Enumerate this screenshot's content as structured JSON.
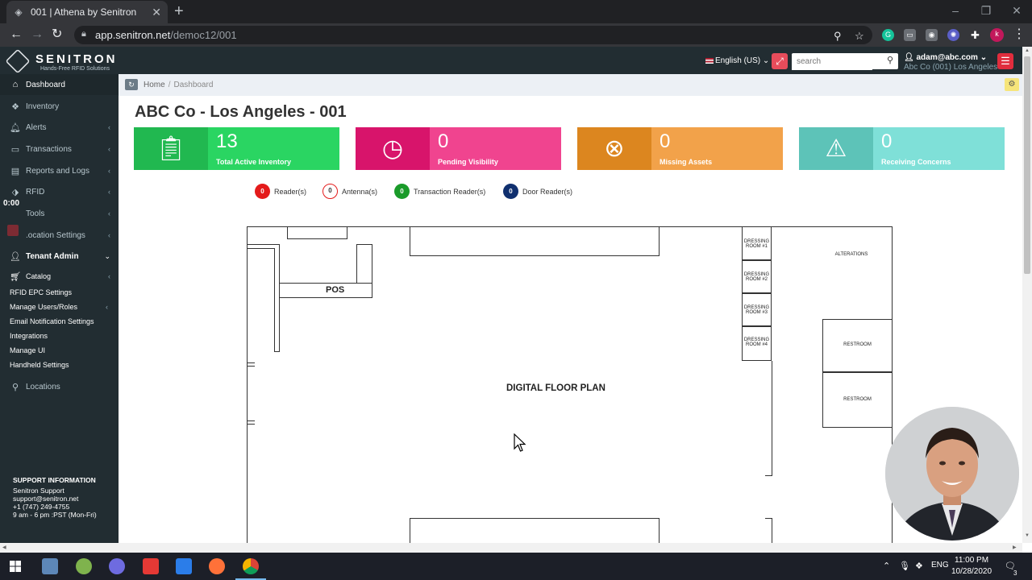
{
  "browser": {
    "tab_title": "001 | Athena by Senitron",
    "url_host": "app.senitron.net",
    "url_path": "/democ12/001"
  },
  "header": {
    "brand": "SENITRON",
    "tagline": "Hands-Free RFID Solutions",
    "language": "English (US)",
    "search_placeholder": "search",
    "user_email": "adam@abc.com",
    "user_org": "Abc Co (001) Los Angeles"
  },
  "sidebar": {
    "items": [
      {
        "label": "Dashboard"
      },
      {
        "label": "Inventory"
      },
      {
        "label": "Alerts"
      },
      {
        "label": "Transactions"
      },
      {
        "label": "Reports and Logs"
      },
      {
        "label": "RFID"
      },
      {
        "label": "Tools"
      },
      {
        "label": ".ocation Settings"
      },
      {
        "label": "Tenant Admin"
      },
      {
        "label": "Catalog"
      }
    ],
    "sub_items": [
      {
        "label": "RFID EPC Settings"
      },
      {
        "label": "Manage Users/Roles"
      },
      {
        "label": "Email Notification Settings"
      },
      {
        "label": "Integrations"
      },
      {
        "label": "Manage UI"
      },
      {
        "label": "Handheld Settings"
      }
    ],
    "locations": "Locations",
    "timer": "0:00",
    "support": {
      "heading": "SUPPORT INFORMATION",
      "name": "Senitron Support",
      "email": "support@senitron.net",
      "phone": "+1 (747) 249-4755",
      "hours": "9 am - 6 pm :PST (Mon-Fri)"
    }
  },
  "breadcrumb": {
    "home": "Home",
    "separator": "/",
    "current": "Dashboard"
  },
  "page_title": "ABC Co - Los Angeles - 001",
  "kpis": [
    {
      "value": "13",
      "label": "Total Active Inventory",
      "color": "#2ad562",
      "icon_color": "#21b850"
    },
    {
      "value": "0",
      "label": "Pending Visibility",
      "color": "#f0448f",
      "icon_color": "#d8146b"
    },
    {
      "value": "0",
      "label": "Missing Assets",
      "color": "#f2a24a",
      "icon_color": "#dc861f"
    },
    {
      "value": "0",
      "label": "Receiving Concerns",
      "color": "#7fe0d8",
      "icon_color": "#5dc3b8"
    }
  ],
  "legend": [
    {
      "count": "0",
      "label": "Reader(s)",
      "color": "#e41b1b"
    },
    {
      "count": "0",
      "label": "Antenna(s)",
      "color": "#ffffff"
    },
    {
      "count": "0",
      "label": "Transaction Reader(s)",
      "color": "#1a9b2a"
    },
    {
      "count": "0",
      "label": "Door Reader(s)",
      "color": "#10306f"
    }
  ],
  "floor_plan": {
    "title": "DIGITAL FLOOR PLAN",
    "pos": "POS",
    "alterations": "ALTERATIONS",
    "dressing_rooms": [
      "DRESSING ROOM #1",
      "DRESSING ROOM #2",
      "DRESSING ROOM #3",
      "DRESSING ROOM #4"
    ],
    "restrooms": [
      "RESTROOM",
      "RESTROOM"
    ]
  },
  "taskbar": {
    "lang": "ENG",
    "time": "11:00 PM",
    "date": "10/28/2020",
    "notifications": "3"
  }
}
